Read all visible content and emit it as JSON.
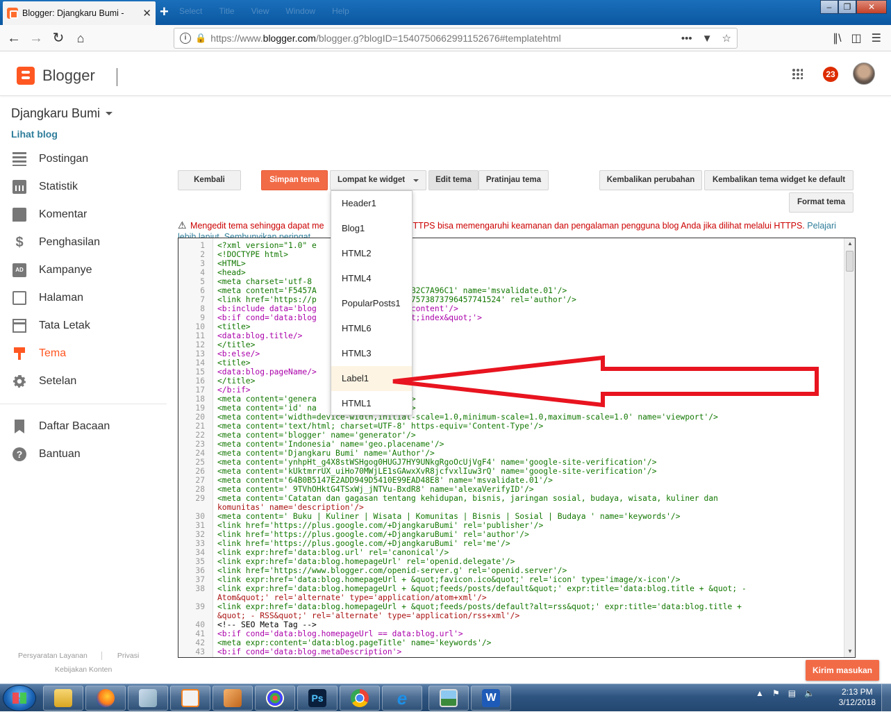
{
  "browser": {
    "tab_title": "Blogger: Djangkaru Bumi -",
    "tab_close": "✕",
    "new_tab": "+",
    "menu_faded": [
      "Select",
      "Title",
      "View",
      "Window",
      "Help"
    ],
    "url_prefix": "https://www.",
    "url_domain": "blogger.com",
    "url_rest": "/blogger.g?blogID=1540750662991152676#templatehtml",
    "url_dots": "•••",
    "win_min": "–",
    "win_max": "❐",
    "win_close": "✕"
  },
  "header": {
    "brand": "Blogger",
    "notif_count": "23"
  },
  "sidebar": {
    "blog_name": "Djangkaru Bumi",
    "view_blog": "Lihat blog",
    "items": [
      {
        "label": "Postingan",
        "icon": "posts-icon"
      },
      {
        "label": "Statistik",
        "icon": "stats-icon"
      },
      {
        "label": "Komentar",
        "icon": "comments-icon"
      },
      {
        "label": "Penghasilan",
        "icon": "dollar-icon"
      },
      {
        "label": "Kampanye",
        "icon": "ad-icon"
      },
      {
        "label": "Halaman",
        "icon": "pages-icon"
      },
      {
        "label": "Tata Letak",
        "icon": "layout-icon"
      },
      {
        "label": "Tema",
        "icon": "theme-icon",
        "active": true
      },
      {
        "label": "Setelan",
        "icon": "gear-icon"
      }
    ],
    "extra": [
      {
        "label": "Daftar Bacaan",
        "icon": "bookmark-icon"
      },
      {
        "label": "Bantuan",
        "icon": "help-icon"
      }
    ],
    "footer": {
      "terms": "Persyaratan Layanan",
      "privacy": "Privasi",
      "content_policy": "Kebijakan Konten"
    }
  },
  "toolbar": {
    "back": "Kembali",
    "save": "Simpan tema",
    "jump": "Lompat ke widget",
    "edit": "Edit tema",
    "preview": "Pratinjau tema",
    "revert": "Kembalikan perubahan",
    "revert_widgets": "Kembalikan tema widget ke default",
    "format": "Format tema"
  },
  "warning": {
    "text": "Mengedit tema sehingga dapat me",
    "text_after": "HTTPS bisa memengaruhi keamanan dan pengalaman pengguna blog Anda jika dilihat melalui HTTPS.",
    "link": "Pelajari",
    "link2": "lebih lanjut",
    "hide": "Sembunyikan peringat"
  },
  "dropdown": {
    "options": [
      "Header1",
      "Blog1",
      "HTML2",
      "HTML4",
      "PopularPosts1",
      "HTML6",
      "HTML3",
      "Label1",
      "HTML1"
    ],
    "highlighted": "Label1"
  },
  "editor": {
    "lines": [
      [
        "1",
        "<?xml version=\"1.0\" e                \" ?>"
      ],
      [
        "2",
        "<!DOCTYPE html>"
      ],
      [
        "3",
        "<HTML>"
      ],
      [
        "4",
        "<head>"
      ],
      [
        "5",
        "<meta charset='utf-8"
      ],
      [
        "6",
        "<meta content='F5457A                 C19B2C7A96C1' name='msvalidate.01'/>"
      ],
      [
        "7",
        "<link href='https://p                 /107573873796457741524' rel='author'/>"
      ],
      [
        "8",
        "<b:include data='blog                 ad-content'/>"
      ],
      [
        "9",
        "<b:if cond='data:blog                 quot;index&quot;'>"
      ],
      [
        "10",
        "<title>"
      ],
      [
        "11",
        "<data:blog.title/>"
      ],
      [
        "12",
        "</title>"
      ],
      [
        "13",
        "<b:else/>"
      ],
      [
        "14",
        "<title>"
      ],
      [
        "15",
        "<data:blog.pageName/>"
      ],
      [
        "16",
        "</title>"
      ],
      [
        "17",
        "</b:if>"
      ],
      [
        "18",
        "<meta content='genera                 g'/>"
      ],
      [
        "19",
        "<meta content='id' na                 y'/>"
      ],
      [
        "20",
        "<meta content='width=device-width,initial-scale=1.0,minimum-scale=1.0,maximum-scale=1.0' name='viewport'/>"
      ],
      [
        "21",
        "<meta content='text/html; charset=UTF-8' https-equiv='Content-Type'/>"
      ],
      [
        "22",
        "<meta content='blogger' name='generator'/>"
      ],
      [
        "23",
        "<meta content='Indonesia' name='geo.placename'/>"
      ],
      [
        "24",
        "<meta content='Djangkaru Bumi' name='Author'/>"
      ],
      [
        "25",
        "<meta content='ynhpHt_g4X8stWSHgog0HUGJ7HY9UNkgRgoOcUjVgF4' name='google-site-verification'/>"
      ],
      [
        "26",
        "<meta content='kUktmrrUX_uiHo70MWjLE1sGAwxXvR8jcfvxlIuw3rQ' name='google-site-verification'/>"
      ],
      [
        "27",
        "<meta content='64B0B5147E2ADD949D5410E99EAD48E8' name='msvalidate.01'/>"
      ],
      [
        "28",
        "<meta content=' 9TVhOHktG4TSxWj_jNTVu-BxdR8' name='alexaVerifyID'/>"
      ],
      [
        "29",
        "<meta content='Catatan dan gagasan tentang kehidupan, bisnis, jaringan sosial, budaya, wisata, kuliner dan"
      ],
      [
        "",
        "komunitas' name='description'/>"
      ],
      [
        "30",
        "<meta content=' Buku | Kuliner | Wisata | Komunitas | Bisnis | Sosial | Budaya ' name='keywords'/>"
      ],
      [
        "31",
        "<link href='https://plus.google.com/+DjangkaruBumi' rel='publisher'/>"
      ],
      [
        "32",
        "<link href='https://plus.google.com/+DjangkaruBumi' rel='author'/>"
      ],
      [
        "33",
        "<link href='https://plus.google.com/+DjangkaruBumi' rel='me'/>"
      ],
      [
        "34",
        "<link expr:href='data:blog.url' rel='canonical'/>"
      ],
      [
        "35",
        "<link expr:href='data:blog.homepageUrl' rel='openid.delegate'/>"
      ],
      [
        "36",
        "<link href='https://www.blogger.com/openid-server.g' rel='openid.server'/>"
      ],
      [
        "37",
        "<link expr:href='data:blog.homepageUrl + &quot;favicon.ico&quot;' rel='icon' type='image/x-icon'/>"
      ],
      [
        "38",
        "<link expr:href='data:blog.homepageUrl + &quot;feeds/posts/default&quot;' expr:title='data:blog.title + &quot; -"
      ],
      [
        "",
        "Atom&quot;' rel='alternate' type='application/atom+xml'/>"
      ],
      [
        "39",
        "<link expr:href='data:blog.homepageUrl + &quot;feeds/posts/default?alt=rss&quot;' expr:title='data:blog.title +"
      ],
      [
        "",
        "&quot; - RSS&quot;' rel='alternate' type='application/rss+xml'/>"
      ],
      [
        "40",
        "<!-- SEO Meta Tag -->"
      ],
      [
        "41",
        "<b:if cond='data:blog.homepageUrl == data:blog.url'>"
      ],
      [
        "42",
        "<meta expr:content='data:blog.pageTitle' name='keywords'/>"
      ],
      [
        "43",
        "<b:if cond='data:blog.metaDescription'>"
      ]
    ]
  },
  "signin": "Kirim masukan",
  "taskbar": {
    "time": "2:13 PM",
    "date": "3/12/2018",
    "apps": [
      "explorer-icon",
      "firefox-icon",
      "notepad-icon",
      "media-player-icon",
      "notebook-icon",
      "paint-icon",
      "photoshop-icon",
      "chrome-icon",
      "ie-icon",
      "photos-icon",
      "word-icon"
    ]
  },
  "colors": {
    "accent": "#ff5722",
    "primary_button": "#f26b47",
    "warning_text": "#cc0000",
    "link": "#2e7d9a",
    "arrow": "#e8141f"
  }
}
